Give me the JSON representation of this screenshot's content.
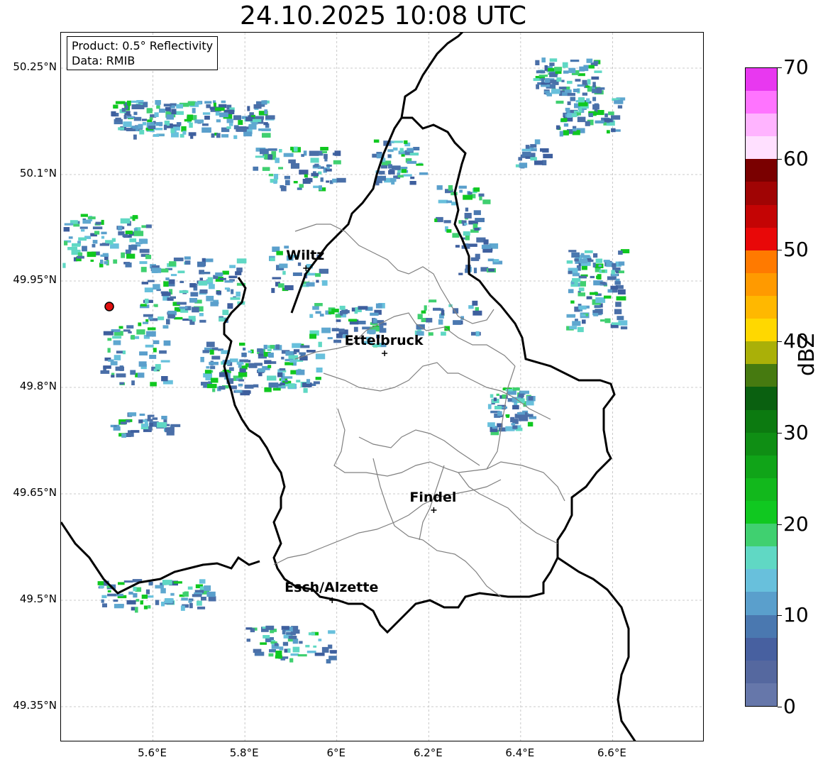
{
  "title": "24.10.2025 10:08 UTC",
  "info": {
    "product": "Product: 0.5° Reflectivity",
    "data": "Data: RMIB"
  },
  "axes": {
    "lat_ticks": [
      "50.25°N",
      "50.1°N",
      "49.95°N",
      "49.8°N",
      "49.65°N",
      "49.5°N",
      "49.35°N"
    ],
    "lon_ticks": [
      "5.6°E",
      "5.8°E",
      "6°E",
      "6.2°E",
      "6.4°E",
      "6.6°E"
    ],
    "lon_range": [
      5.4,
      6.8
    ],
    "lat_range": [
      49.3,
      50.3
    ]
  },
  "cities": [
    {
      "name": "Wiltz",
      "lon": 5.933,
      "lat": 49.968
    },
    {
      "name": "Ettelbruck",
      "lon": 6.104,
      "lat": 49.848
    },
    {
      "name": "Findel",
      "lon": 6.211,
      "lat": 49.627
    },
    {
      "name": "Esch/Alzette",
      "lon": 5.99,
      "lat": 49.5
    }
  ],
  "radar_site": {
    "lon": 5.505,
    "lat": 49.914
  },
  "colorbar": {
    "label": "dBZ",
    "ticks": [
      "0",
      "10",
      "20",
      "30",
      "40",
      "50",
      "60",
      "70"
    ],
    "min": 0,
    "max": 70,
    "colors": [
      "#6677aa",
      "#55689f",
      "#4760a0",
      "#4a78b0",
      "#5a9fcc",
      "#68c0dc",
      "#60d8c4",
      "#40d070",
      "#10c820",
      "#12b81c",
      "#10a418",
      "#0f8e14",
      "#0c7a10",
      "#0a6010",
      "#467a10",
      "#aab008",
      "#ffd800",
      "#ffb800",
      "#ff9a00",
      "#ff7a00",
      "#e80808",
      "#c40404",
      "#a00404",
      "#7a0000",
      "#ffe0ff",
      "#ffb4ff",
      "#ff74ff",
      "#e838f0"
    ]
  }
}
